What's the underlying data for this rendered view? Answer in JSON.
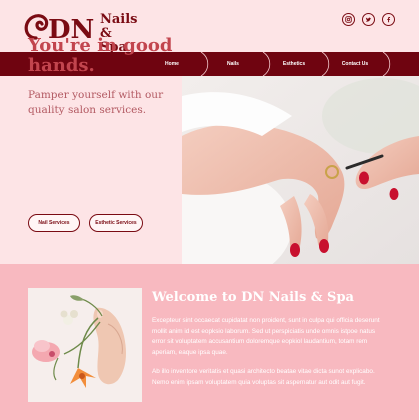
{
  "brand": {
    "logo_initials": "DN",
    "name_line1": "Nails",
    "name_line2": "& Spa",
    "colors": {
      "primary": "#6f0410",
      "accent": "#c2454e",
      "background": "#fde4e6",
      "section": "#f8b9c0"
    }
  },
  "socials": [
    {
      "icon": "instagram-icon"
    },
    {
      "icon": "twitter-icon"
    },
    {
      "icon": "facebook-icon"
    }
  ],
  "nav": {
    "items": [
      {
        "label": "Home"
      },
      {
        "label": "Nails"
      },
      {
        "label": "Esthetics"
      },
      {
        "label": "Contact Us"
      }
    ]
  },
  "hero": {
    "title": "You're in good hands.",
    "subtitle": "Pamper yourself with our quality salon services.",
    "buttons": {
      "nail_services": "Nail Services",
      "esthetic_services": "Esthetic Services"
    },
    "photo": "manicure-hands-photo"
  },
  "welcome": {
    "title": "Welcome to DN Nails & Spa",
    "paragraph1": "Excepteur sint occaecat cupidatat non proident, sunt in culpa qui officia deserunt mollit anim id est eopksio laborum. Sed ut perspiciatis unde omnis istpoe natus error sit voluptatem accusantium doloremque eopkiol laudantium, totam rem aperiam, eaque ipsa quae.",
    "paragraph2": "Ab illo inventore veritatis et quasi architecto beatae vitae dicta sunot explicabo. Nemo enim ipsam voluptatem quia voluptas sit aspernatur aut odit aut fugit.",
    "photo": "hand-with-flowers-photo"
  }
}
